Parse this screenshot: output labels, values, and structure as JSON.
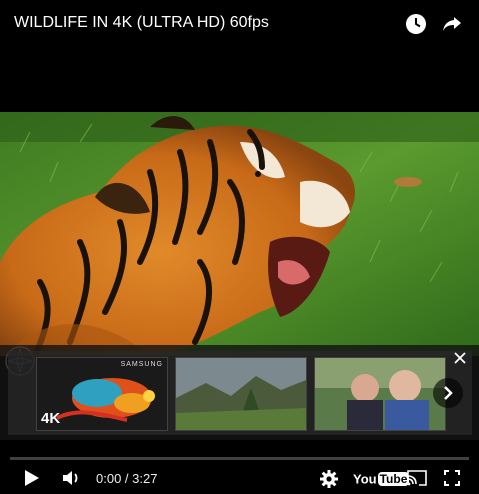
{
  "video_title": "WILDLIFE IN 4K (ULTRA HD) 60fps",
  "icons": {
    "watch_later": "clock-icon",
    "share": "share-arrow-icon",
    "play": "play-icon",
    "volume": "volume-icon",
    "settings": "gear-icon",
    "youtube": "youtube-logo",
    "cast": "cast-icon",
    "fullscreen": "fullscreen-icon",
    "close": "close-icon",
    "next": "chevron-right-icon"
  },
  "endscreen": {
    "items": [
      {
        "brand": "SAMSUNG",
        "badge": "4K"
      },
      {},
      {}
    ]
  },
  "player": {
    "current_time": "0:00",
    "separator": "/",
    "duration": "3:27",
    "time_display": "0:00 / 3:27",
    "progress_fraction": 0,
    "youtube_logo_text": "You",
    "youtube_logo_tube": "Tube"
  },
  "colors": {
    "background": "#000000",
    "youtube_red": "#ff0000",
    "progress_track": "#5f5f5f",
    "text": "#ffffff"
  }
}
